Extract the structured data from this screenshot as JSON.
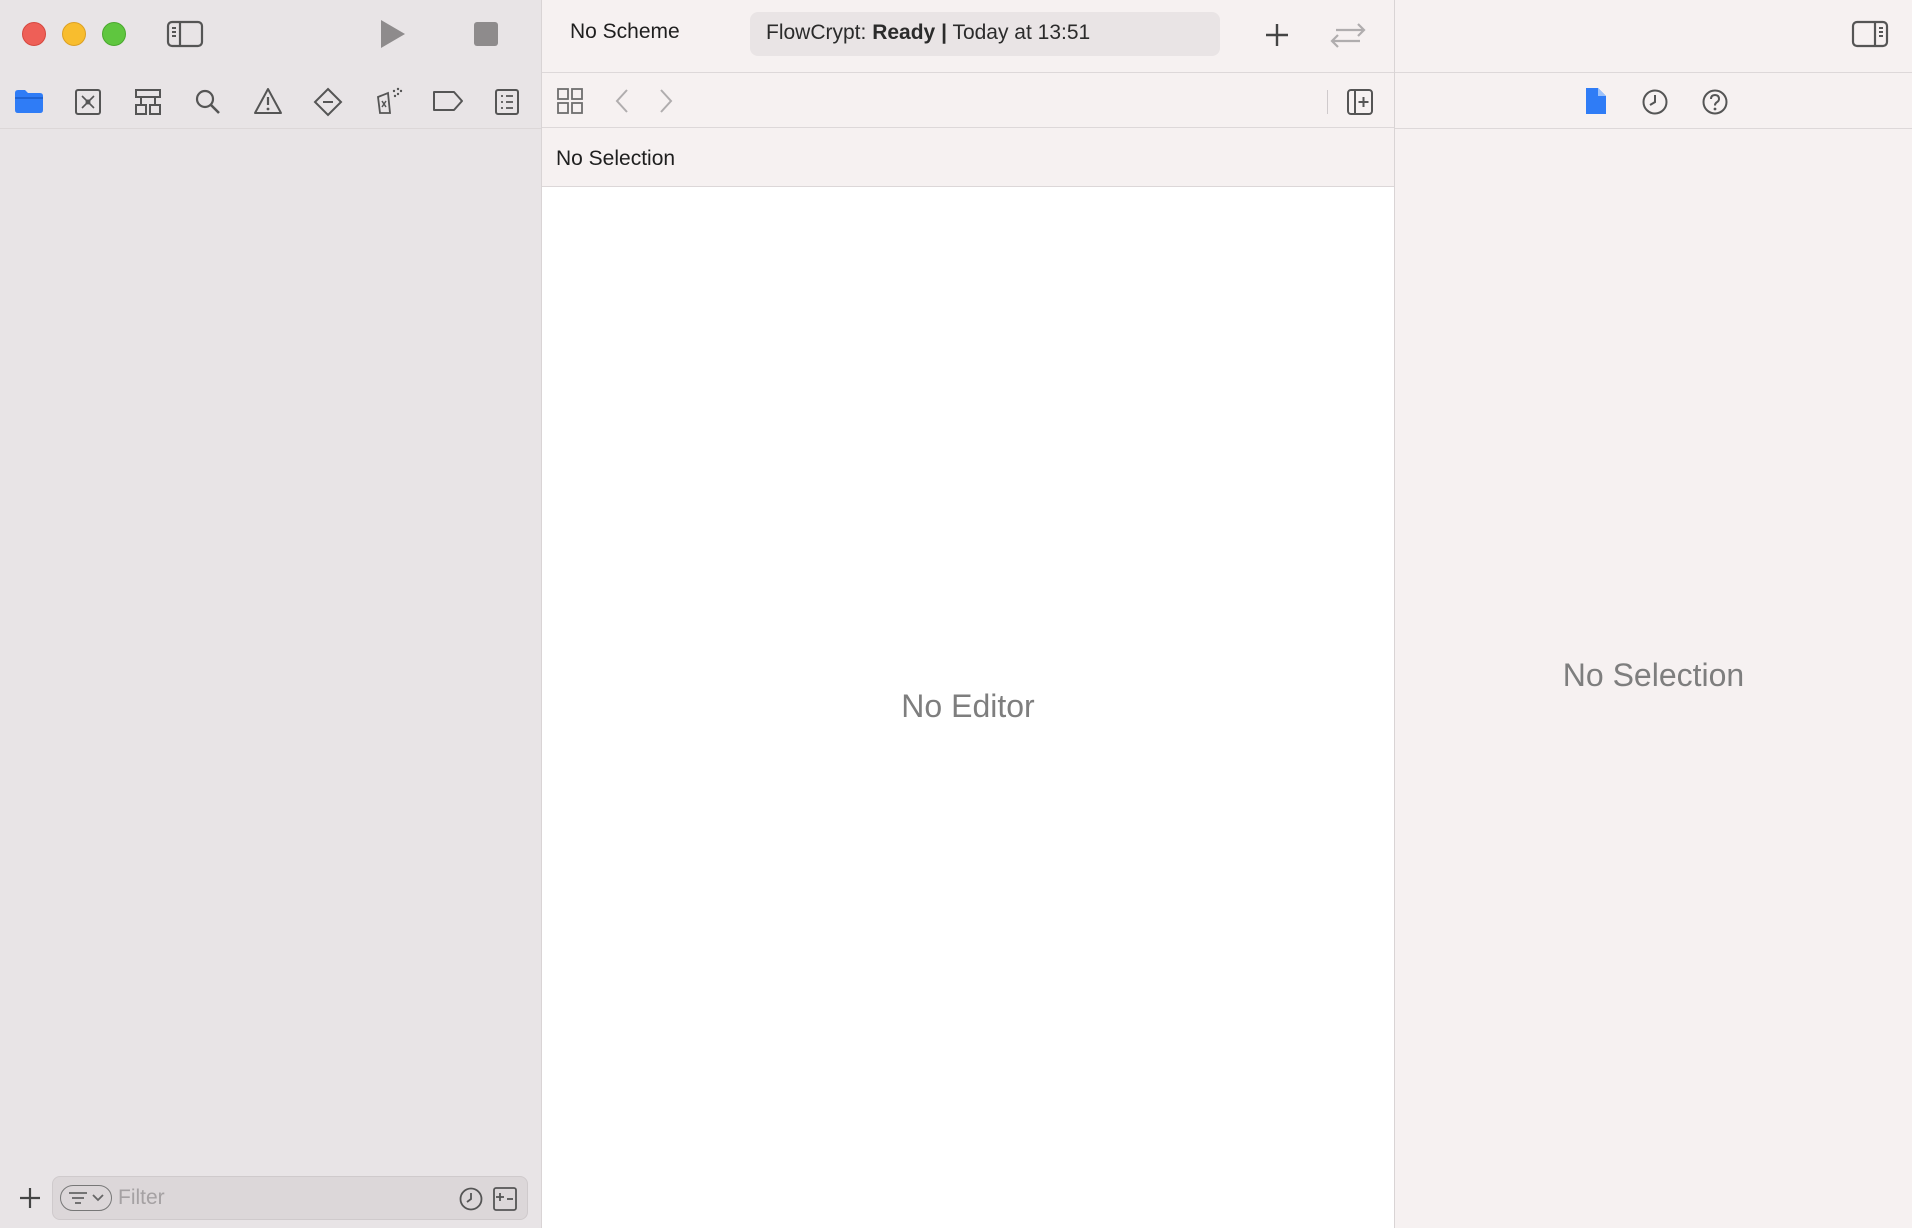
{
  "window": {
    "traffic_lights": {
      "close_color": "#ee5f57",
      "minimize_color": "#f8bd2e",
      "zoom_color": "#5fc63f"
    }
  },
  "toolbar": {
    "scheme_label": "No Scheme",
    "activity": {
      "app": "FlowCrypt:",
      "status": "Ready",
      "separator": "|",
      "time": "Today at 13:51"
    },
    "icons": [
      "sidebar-toggle-icon",
      "run-icon",
      "stop-icon",
      "add-icon",
      "code-review-icon",
      "inspector-toggle-icon"
    ]
  },
  "navigator": {
    "selected_tab": "project-navigator",
    "tabs": [
      "folder-icon",
      "source-control-icon",
      "symbol-icon",
      "search-icon",
      "issue-icon",
      "test-icon",
      "debug-icon",
      "breakpoint-icon",
      "report-icon"
    ],
    "filter": {
      "placeholder": "Filter",
      "value": ""
    }
  },
  "editor": {
    "breadcrumb": "No Selection",
    "empty_message": "No Editor"
  },
  "inspector": {
    "tabs": [
      "file-inspector-icon",
      "history-inspector-icon",
      "quick-help-icon"
    ],
    "empty_message": "No Selection"
  },
  "colors": {
    "accent": "#2f7cf6",
    "icon_gray": "#6e6e6e",
    "disabled_gray": "#b0adae"
  }
}
